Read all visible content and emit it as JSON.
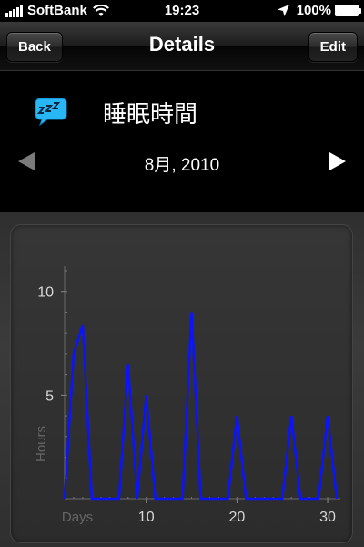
{
  "status_bar": {
    "carrier": "SoftBank",
    "time": "19:23",
    "battery": "100%"
  },
  "nav": {
    "back_label": "Back",
    "title": "Details",
    "edit_label": "Edit"
  },
  "header": {
    "title": "睡眠時間",
    "date": "8月, 2010",
    "icon": "sleep-bubble-icon",
    "icon_color": "#29b6f6"
  },
  "chart_data": {
    "type": "line",
    "xlabel": "Days",
    "ylabel": "Hours",
    "xlim": [
      1,
      31
    ],
    "ylim": [
      0,
      11
    ],
    "xticks": [
      10,
      20,
      30
    ],
    "yticks": [
      5,
      10
    ],
    "line_color": "#0a14ff",
    "series": [
      {
        "x": [
          1,
          2,
          3,
          4,
          5,
          6,
          7,
          8,
          9,
          10,
          11,
          12,
          13,
          14,
          15,
          16,
          17,
          18,
          19,
          20,
          21,
          22,
          23,
          24,
          25,
          26,
          27,
          28,
          29,
          30,
          31
        ],
        "values": [
          0,
          7,
          8.4,
          0,
          0,
          0,
          0,
          6.5,
          0,
          5,
          0,
          0,
          0,
          0,
          9,
          0,
          0,
          0,
          0,
          4,
          0,
          0,
          0,
          0,
          0,
          4,
          0,
          0,
          0,
          4,
          0
        ]
      }
    ]
  }
}
